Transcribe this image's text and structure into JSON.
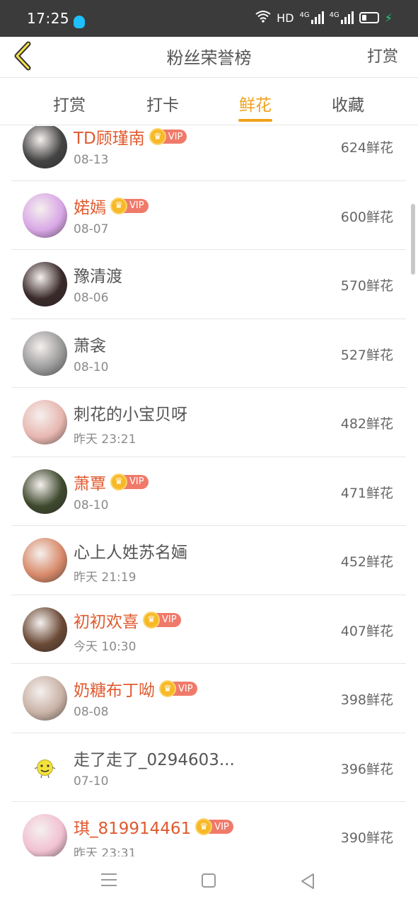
{
  "status_bar": {
    "time": "17:25",
    "hd": "HD",
    "net1": "4G",
    "net2": "4G"
  },
  "nav": {
    "title": "粉丝荣誉榜",
    "action": "打赏"
  },
  "tabs": [
    {
      "label": "打赏"
    },
    {
      "label": "打卡"
    },
    {
      "label": "鲜花"
    },
    {
      "label": "收藏"
    }
  ],
  "active_tab": "鲜花",
  "vip_label": "VIP",
  "rows": [
    {
      "name": "TD顾瑾南",
      "vip": true,
      "date": "08-13",
      "count": "624鲜花",
      "avatar_color": "#444"
    },
    {
      "name": "婼嫣",
      "vip": true,
      "date": "08-07",
      "count": "600鲜花",
      "avatar_color": "#d9a7e6"
    },
    {
      "name": "豫清渡",
      "vip": false,
      "date": "08-06",
      "count": "570鲜花",
      "avatar_color": "#3a2a2a"
    },
    {
      "name": "萧衾",
      "vip": false,
      "date": "08-10",
      "count": "527鲜花",
      "avatar_color": "#9a9a9a"
    },
    {
      "name": "刺花的小宝贝呀",
      "vip": false,
      "date": "昨天 23:21",
      "count": "482鲜花",
      "avatar_color": "#e8b7b0"
    },
    {
      "name": "萧覃",
      "vip": true,
      "date": "08-10",
      "count": "471鲜花",
      "avatar_color": "#3f4a2e"
    },
    {
      "name": "心上人姓苏名婳",
      "vip": false,
      "date": "昨天 21:19",
      "count": "452鲜花",
      "avatar_color": "#d88a6a"
    },
    {
      "name": "初初欢喜",
      "vip": true,
      "date": "今天 10:30",
      "count": "407鲜花",
      "avatar_color": "#6b4a36"
    },
    {
      "name": "奶糖布丁呦",
      "vip": true,
      "date": "08-08",
      "count": "398鲜花",
      "avatar_color": "#c9b2a6"
    },
    {
      "name": "走了走了_0294603...",
      "vip": false,
      "date": "07-10",
      "count": "396鲜花",
      "avatar_color": "#ffffff"
    },
    {
      "name": "琪_819914461",
      "vip": true,
      "date": "昨天 23:31",
      "count": "390鲜花",
      "avatar_color": "#f1c1d2"
    }
  ]
}
